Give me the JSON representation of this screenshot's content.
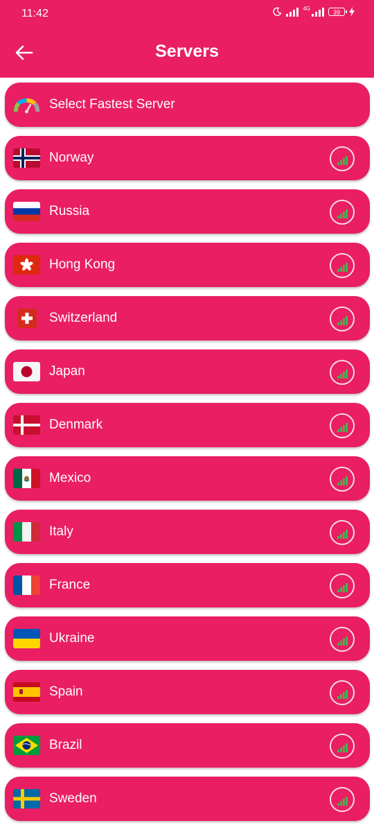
{
  "status_bar": {
    "time": "11:42",
    "network": "4G",
    "battery": "39"
  },
  "header": {
    "title": "Servers"
  },
  "fastest": {
    "label": "Select Fastest Server"
  },
  "servers": [
    {
      "name": "Norway",
      "flag": "norway-flag"
    },
    {
      "name": "Russia",
      "flag": "russia-flag"
    },
    {
      "name": "Hong Kong",
      "flag": "hong-kong-flag"
    },
    {
      "name": "Switzerland",
      "flag": "switzerland-flag"
    },
    {
      "name": "Japan",
      "flag": "japan-flag"
    },
    {
      "name": "Denmark",
      "flag": "denmark-flag"
    },
    {
      "name": "Mexico",
      "flag": "mexico-flag"
    },
    {
      "name": "Italy",
      "flag": "italy-flag"
    },
    {
      "name": "France",
      "flag": "france-flag"
    },
    {
      "name": "Ukraine",
      "flag": "ukraine-flag"
    },
    {
      "name": "Spain",
      "flag": "spain-flag"
    },
    {
      "name": "Brazil",
      "flag": "brazil-flag"
    },
    {
      "name": "Sweden",
      "flag": "sweden-flag"
    }
  ],
  "colors": {
    "primary": "#e91e63",
    "signal": "#4caf50"
  }
}
